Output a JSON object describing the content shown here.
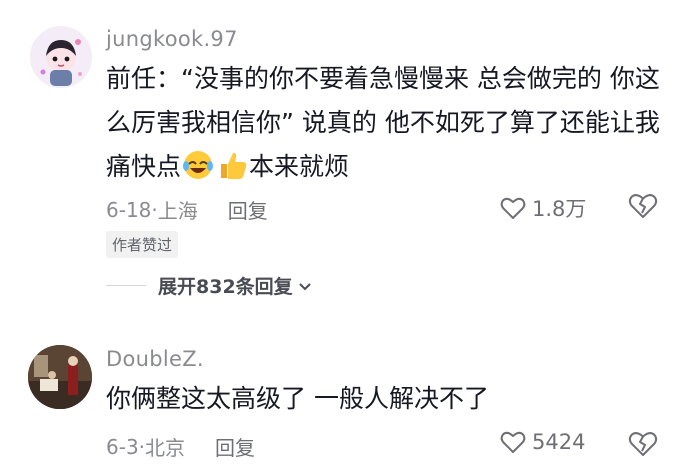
{
  "comments": [
    {
      "username": "jungkook.97",
      "text": "前任：“没事的你不要着急慢慢来 总会做完的 你这么厉害我相信你” 说真的 他不如死了算了还能让我痛快点",
      "text_after_emoji": "本来就烦",
      "date": "6-18",
      "location": "上海",
      "reply_label": "回复",
      "likes": "1.8万",
      "badge": "作者赞过"
    },
    {
      "username": "DoubleZ.",
      "text": "你俩整这太高级了 一般人解决不了",
      "date": "6-3",
      "location": "北京",
      "reply_label": "回复",
      "likes": "5424"
    }
  ],
  "expand_replies": {
    "label": "展开832条回复"
  },
  "icons": {
    "like": "heart-outline-icon",
    "dislike": "broken-heart-icon",
    "expand": "chevron-down-icon",
    "emoji1": "laughing-tears-emoji",
    "emoji2": "thumbs-up-emoji"
  },
  "colors": {
    "text": "#161823",
    "meta": "#8a8b91",
    "badge_bg": "#f1f1f2"
  }
}
